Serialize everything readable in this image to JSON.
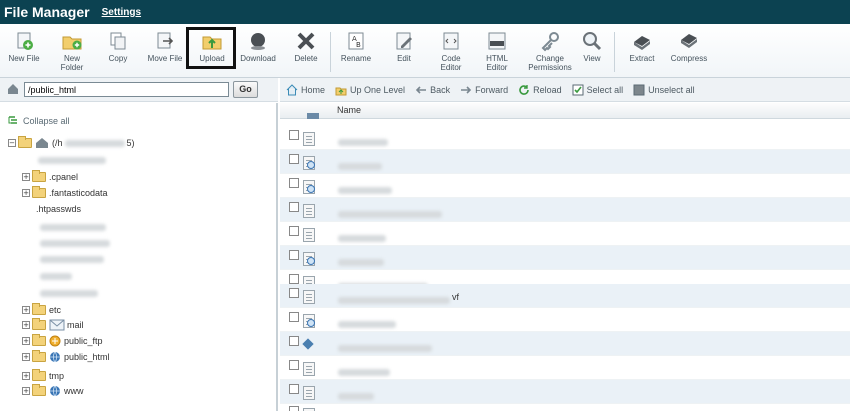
{
  "header": {
    "title": "File Manager",
    "settings_label": "Settings"
  },
  "toolbar": {
    "buttons": [
      {
        "label": "New File",
        "icon": "new-file-icon"
      },
      {
        "label": "New\nFolder",
        "icon": "new-folder-icon"
      },
      {
        "label": "Copy",
        "icon": "copy-icon"
      },
      {
        "label": "Move File",
        "icon": "move-file-icon"
      },
      {
        "label": "Upload",
        "icon": "upload-icon"
      },
      {
        "label": "Download",
        "icon": "download-icon"
      },
      {
        "label": "Delete",
        "icon": "delete-icon"
      },
      {
        "label": "Rename",
        "icon": "rename-icon"
      },
      {
        "label": "Edit",
        "icon": "edit-icon"
      },
      {
        "label": "Code\nEditor",
        "icon": "code-editor-icon"
      },
      {
        "label": "HTML\nEditor",
        "icon": "html-editor-icon"
      },
      {
        "label": "Change\nPermissions",
        "icon": "permissions-icon"
      },
      {
        "label": "View",
        "icon": "view-icon"
      },
      {
        "label": "Extract",
        "icon": "extract-icon"
      },
      {
        "label": "Compress",
        "icon": "compress-icon"
      }
    ]
  },
  "pathbar": {
    "path_value": "/public_html",
    "go_label": "Go"
  },
  "navbar": {
    "home": "Home",
    "up_one_level": "Up One Level",
    "back": "Back",
    "forward": "Forward",
    "reload": "Reload",
    "select_all": "Select all",
    "unselect_all": "Unselect all"
  },
  "tree": {
    "collapse_label": "Collapse all",
    "root_label_prefix": "(/h",
    "root_label_suffix": "5)",
    "items": {
      "cpanel": ".cpanel",
      "fantasticodata": ".fantasticodata",
      "htpasswds": ".htpasswds",
      "etc": "etc",
      "mail": "mail",
      "public_ftp": "public_ftp",
      "public_html": "public_html",
      "tmp": "tmp",
      "www": "www"
    }
  },
  "filelist": {
    "name_header": "Name",
    "visible_suffix": "vf"
  },
  "colors": {
    "titlebar": "#0c4251",
    "row_alt": "#eaf1f7",
    "accent": "#3975b5"
  }
}
